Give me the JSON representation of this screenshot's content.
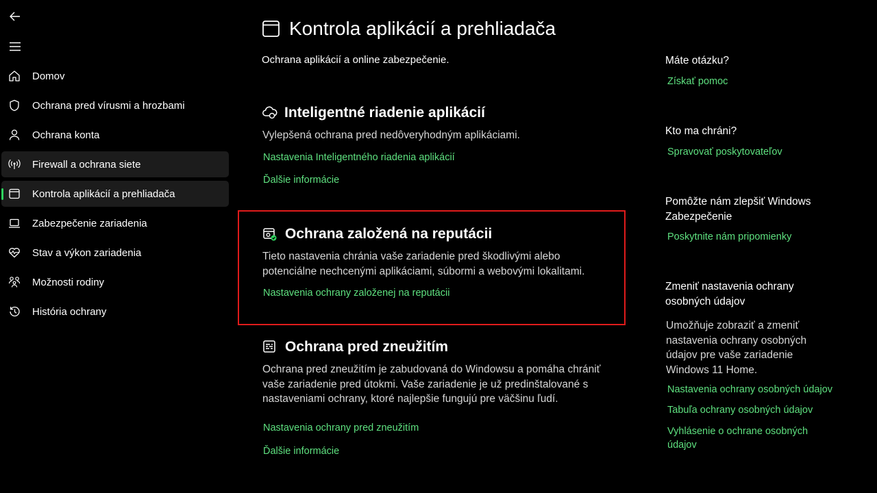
{
  "sidebar": {
    "items": [
      {
        "label": "Domov",
        "icon": "home-icon"
      },
      {
        "label": "Ochrana pred vírusmi a hrozbami",
        "icon": "shield-icon"
      },
      {
        "label": "Ochrana konta",
        "icon": "person-icon"
      },
      {
        "label": "Firewall a ochrana siete",
        "icon": "wifi-signal-icon"
      },
      {
        "label": "Kontrola aplikácií a prehliadača",
        "icon": "app-window-icon"
      },
      {
        "label": "Zabezpečenie zariadenia",
        "icon": "laptop-icon"
      },
      {
        "label": "Stav a výkon zariadenia",
        "icon": "heart-pulse-icon"
      },
      {
        "label": "Možnosti rodiny",
        "icon": "family-icon"
      },
      {
        "label": "História ochrany",
        "icon": "history-icon"
      }
    ],
    "selected_index": 4
  },
  "page": {
    "title": "Kontrola aplikácií a prehliadača",
    "subtitle": "Ochrana aplikácií a online zabezpečenie."
  },
  "sections": [
    {
      "title": "Inteligentné riadenie aplikácií",
      "icon": "smart-app-control-icon",
      "description": "Vylepšená ochrana pred nedôveryhodným aplikáciami.",
      "links": [
        "Nastavenia Inteligentného riadenia aplikácií",
        "Ďalšie informácie"
      ]
    },
    {
      "title": "Ochrana založená na reputácii",
      "icon": "reputation-protection-icon",
      "description_lines": [
        "Tieto nastavenia chránia vaše zariadenie pred škodlivými alebo",
        "potenciálne nechcenými aplikáciami, súbormi a webovými lokalitami."
      ],
      "links": [
        "Nastavenia ochrany založenej na reputácii"
      ]
    },
    {
      "title": "Ochrana pred zneužitím",
      "icon": "exploit-protection-icon",
      "description_lines": [
        "Ochrana pred zneužitím je zabudovaná do Windowsu a pomáha chrániť",
        "vaše zariadenie pred útokmi.  Vaše zariadenie je už predinštalované s",
        "nastaveniami ochrany, ktoré najlepšie fungujú pre väčšinu ľudí."
      ],
      "links": [
        "Nastavenia ochrany pred zneužitím",
        "Ďalšie informácie"
      ]
    }
  ],
  "aside": {
    "question": {
      "heading": "Máte otázku?",
      "link": "Získať pomoc"
    },
    "protect": {
      "heading": "Kto ma chráni?",
      "link": "Spravovať poskytovateľov"
    },
    "improve": {
      "heading_lines": [
        "Pomôžte nám zlepšiť Windows",
        "Zabezpečenie"
      ],
      "link": "Poskytnite nám pripomienky"
    },
    "privacy": {
      "heading_lines": [
        "Zmeniť nastavenia ochrany",
        "osobných údajov"
      ],
      "text_lines": [
        "Umožňuje zobraziť a zmeniť",
        "nastavenia ochrany osobných",
        "údajov pre vaše zariadenie",
        "Windows 11 Home."
      ],
      "links": [
        "Nastavenia ochrany osobných údajov",
        "Tabuľa ochrany osobných údajov"
      ],
      "statement_lines": [
        "Vyhlásenie o ochrane osobných",
        "údajov"
      ]
    }
  },
  "colors": {
    "accent": "#5ee07f",
    "indicator": "#2fd35e",
    "focus_border": "#e01b1b",
    "background": "#000000"
  }
}
